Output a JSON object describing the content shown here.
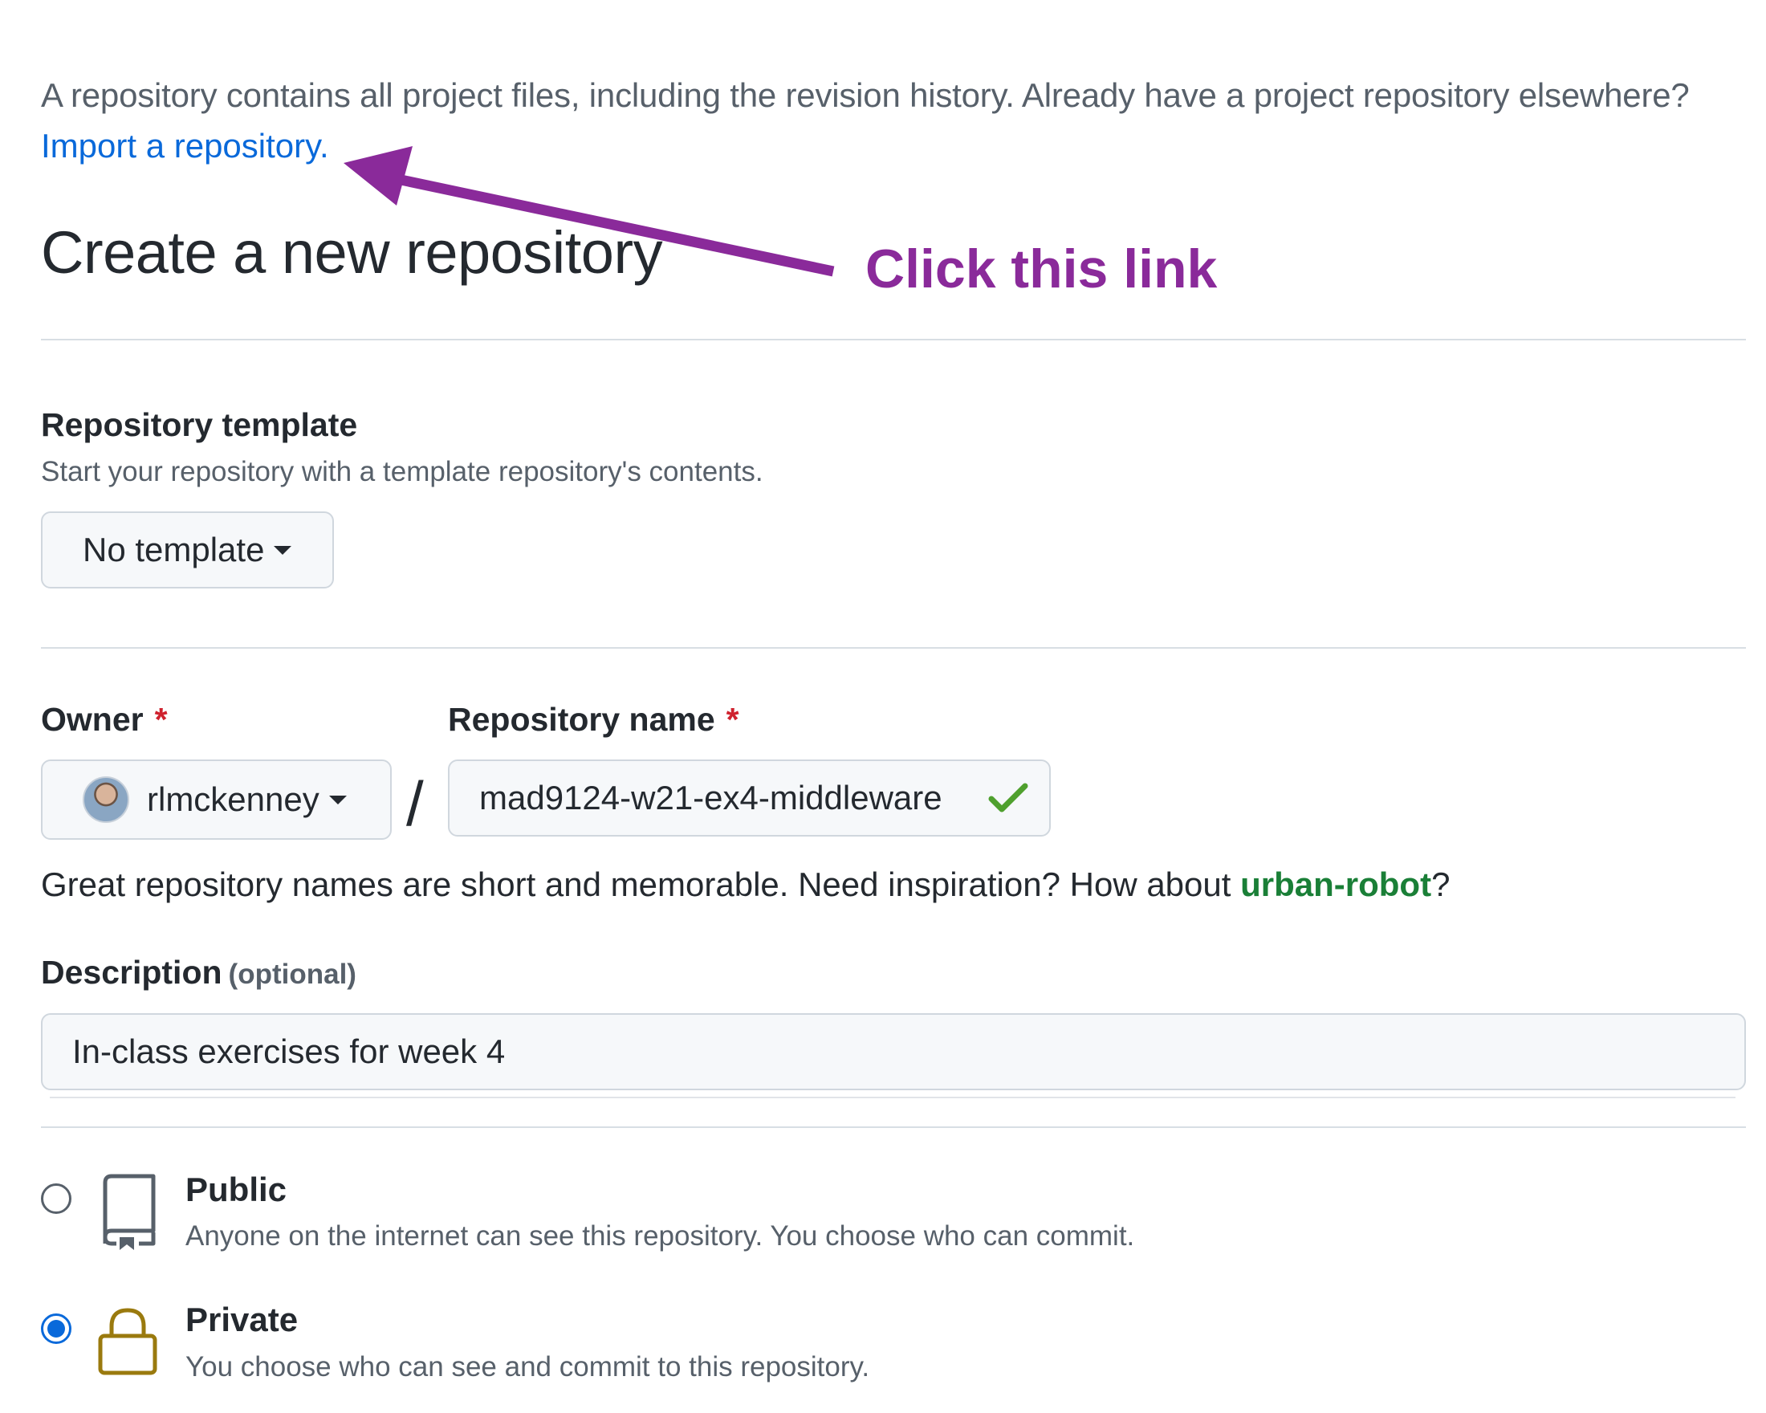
{
  "intro_text": "A repository contains all project files, including the revision history. Already have a project repository elsewhere?",
  "import_link": "Import a repository.",
  "page_title": "Create a new repository",
  "annotation": {
    "text": "Click this link",
    "color": "#8a2a9a"
  },
  "template": {
    "label": "Repository template",
    "help": "Start your repository with a template repository's contents.",
    "button": "No template"
  },
  "owner": {
    "label": "Owner",
    "required": "*",
    "value": "rlmckenney"
  },
  "separator": "/",
  "repo_name": {
    "label": "Repository name",
    "required": "*",
    "value": "mad9124-w21-ex4-middleware",
    "valid_icon": "check-icon"
  },
  "name_hint": {
    "prefix": "Great repository names are short and memorable. Need inspiration? How about ",
    "suggestion": "urban-robot",
    "suffix": "?"
  },
  "description": {
    "label": "Description",
    "optional": "(optional)",
    "value": "In-class exercises for week 4"
  },
  "visibility": [
    {
      "title": "Public",
      "desc": "Anyone on the internet can see this repository. You choose who can commit.",
      "icon": "repo-icon",
      "checked": false
    },
    {
      "title": "Private",
      "desc": "You choose who can see and commit to this repository.",
      "icon": "lock-icon",
      "checked": true
    }
  ],
  "colors": {
    "link": "#0969da",
    "suggestion": "#1a7f37",
    "required": "#cf222e",
    "lock": "#9a7a0e",
    "check": "#4fa02e"
  }
}
